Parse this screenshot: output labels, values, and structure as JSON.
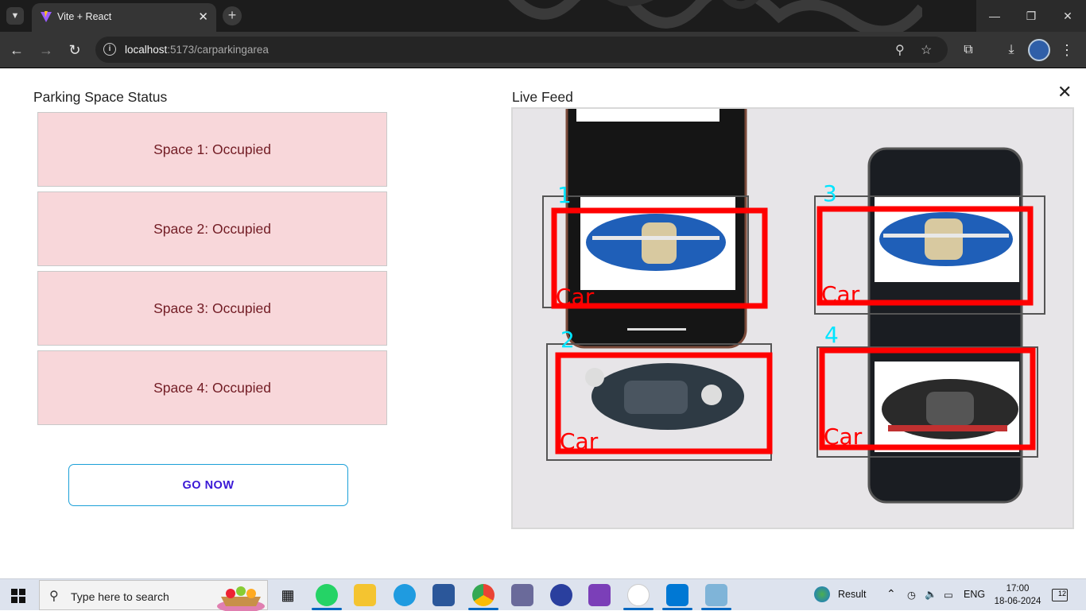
{
  "browser": {
    "tab_title": "Vite + React",
    "url_host": "localhost",
    "url_path": ":5173/carparkingarea"
  },
  "page": {
    "status_heading": "Parking Space Status",
    "feed_heading": "Live Feed",
    "spaces": [
      {
        "label": "Space 1: Occupied"
      },
      {
        "label": "Space 2: Occupied"
      },
      {
        "label": "Space 3: Occupied"
      },
      {
        "label": "Space 4: Occupied"
      }
    ],
    "go_button": "GO NOW",
    "feed_overlays": [
      {
        "slot": "1",
        "class": "Car"
      },
      {
        "slot": "2",
        "class": "Car"
      },
      {
        "slot": "3",
        "class": "Car"
      },
      {
        "slot": "4",
        "class": "Car"
      }
    ]
  },
  "taskbar": {
    "search_placeholder": "Type here to search",
    "weather_label": "Result",
    "language": "ENG",
    "time": "17:00",
    "date": "18-06-2024",
    "notification_count": "12"
  },
  "colors": {
    "occupied_bg": "#f8d7da",
    "occupied_text": "#721c24",
    "button_border": "#1ba0d8",
    "button_text": "#3a18d6",
    "detection_box": "#ff0000",
    "slot_number": "#00e5ff"
  }
}
